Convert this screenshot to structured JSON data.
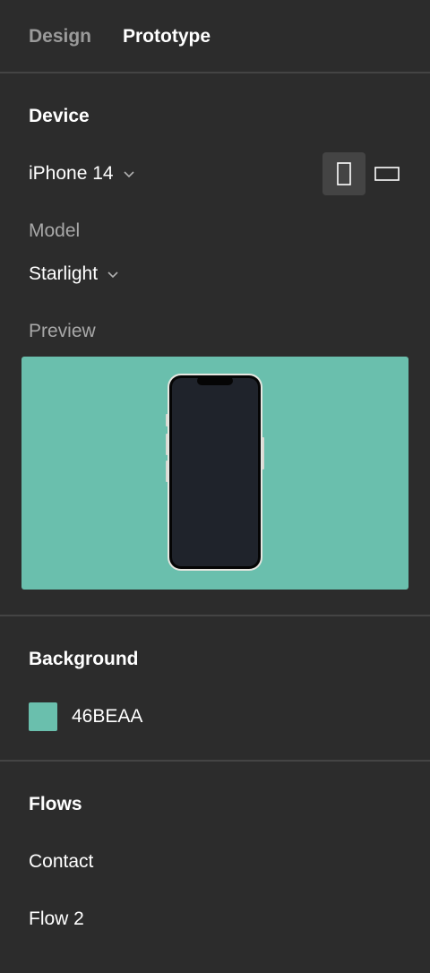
{
  "tabs": {
    "design": "Design",
    "prototype": "Prototype"
  },
  "device_section": {
    "title": "Device",
    "device_name": "iPhone 14",
    "model_label": "Model",
    "model_value": "Starlight",
    "preview_label": "Preview",
    "orientation_selected": "portrait"
  },
  "background_section": {
    "title": "Background",
    "value": "46BEAA",
    "swatch_color": "#6abfad"
  },
  "flows_section": {
    "title": "Flows",
    "items": [
      "Contact",
      "Flow 2"
    ]
  },
  "colors": {
    "panel_bg": "#2c2c2c",
    "preview_bg": "#6abfad",
    "phone_screen": "#1f232b",
    "phone_frame": "#e6e6e0"
  }
}
